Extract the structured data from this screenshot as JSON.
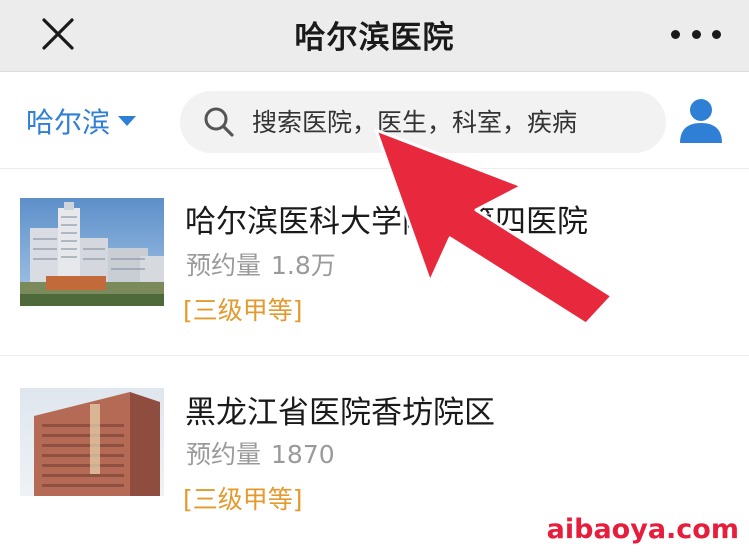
{
  "navbar": {
    "title": "哈尔滨医院",
    "close_icon": "close-icon",
    "more_icon": "more-dots-icon"
  },
  "search": {
    "city": "哈尔滨",
    "placeholder": "搜索医院，医生，科室，疾病",
    "search_icon": "search-icon",
    "user_icon": "user-icon",
    "accent_color": "#2f7fd6"
  },
  "hospitals": [
    {
      "name": "哈尔滨医科大学附属第四医院",
      "bookings_label": "预约量",
      "bookings_value": "1.8万",
      "grade": "[三级甲等]"
    },
    {
      "name": "黑龙江省医院香坊院区",
      "bookings_label": "预约量",
      "bookings_value": "1870",
      "grade": "[三级甲等]"
    }
  ],
  "overlay": {
    "arrow_color": "#e8283c"
  },
  "watermark": "aibaoya.com"
}
